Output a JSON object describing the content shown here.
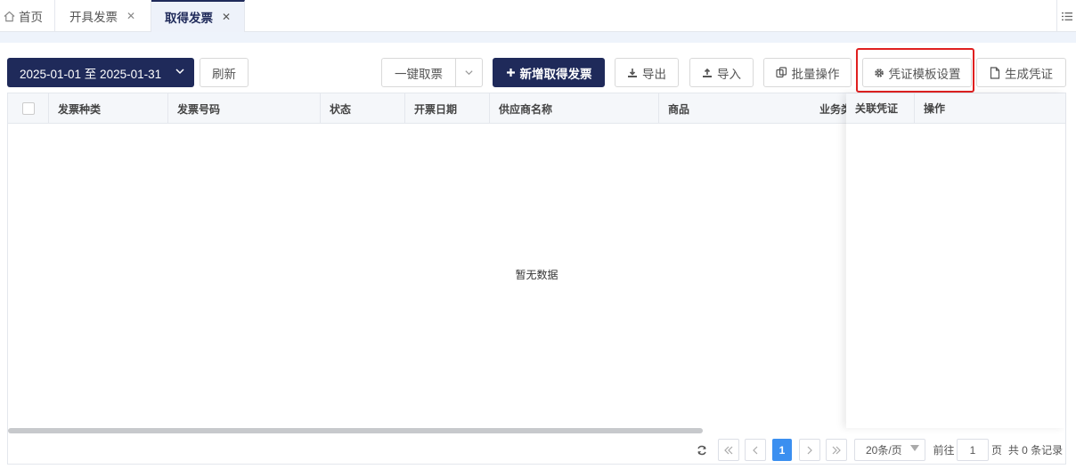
{
  "tabs": [
    {
      "label": "首页",
      "icon": "home-icon",
      "closable": false,
      "active": false
    },
    {
      "label": "开具发票",
      "closable": true,
      "active": false
    },
    {
      "label": "取得发票",
      "closable": true,
      "active": true
    }
  ],
  "tab_close_glyph": "✕",
  "toolbar": {
    "date_range": "2025-01-01 至 2025-01-31",
    "refresh": "刷新",
    "one_click_fetch": "一键取票",
    "add_invoice": "新增取得发票",
    "export": "导出",
    "import": "导入",
    "batch": "批量操作",
    "voucher_template": "凭证模板设置",
    "generate_voucher": "生成凭证"
  },
  "table": {
    "columns": [
      "发票种类",
      "发票号码",
      "状态",
      "开票日期",
      "供应商名称",
      "商品",
      "业务类",
      "关联凭证",
      "操作"
    ],
    "rows": [],
    "empty_text": "暂无数据"
  },
  "pagination": {
    "current_page": "1",
    "page_size": "20条/页",
    "goto_prefix": "前往",
    "goto_value": "1",
    "goto_suffix": "页",
    "total_text": "共 0 条记录"
  },
  "colors": {
    "primary": "#1f2a5a",
    "highlight": "#e02020",
    "page_active": "#3b8ff0"
  }
}
